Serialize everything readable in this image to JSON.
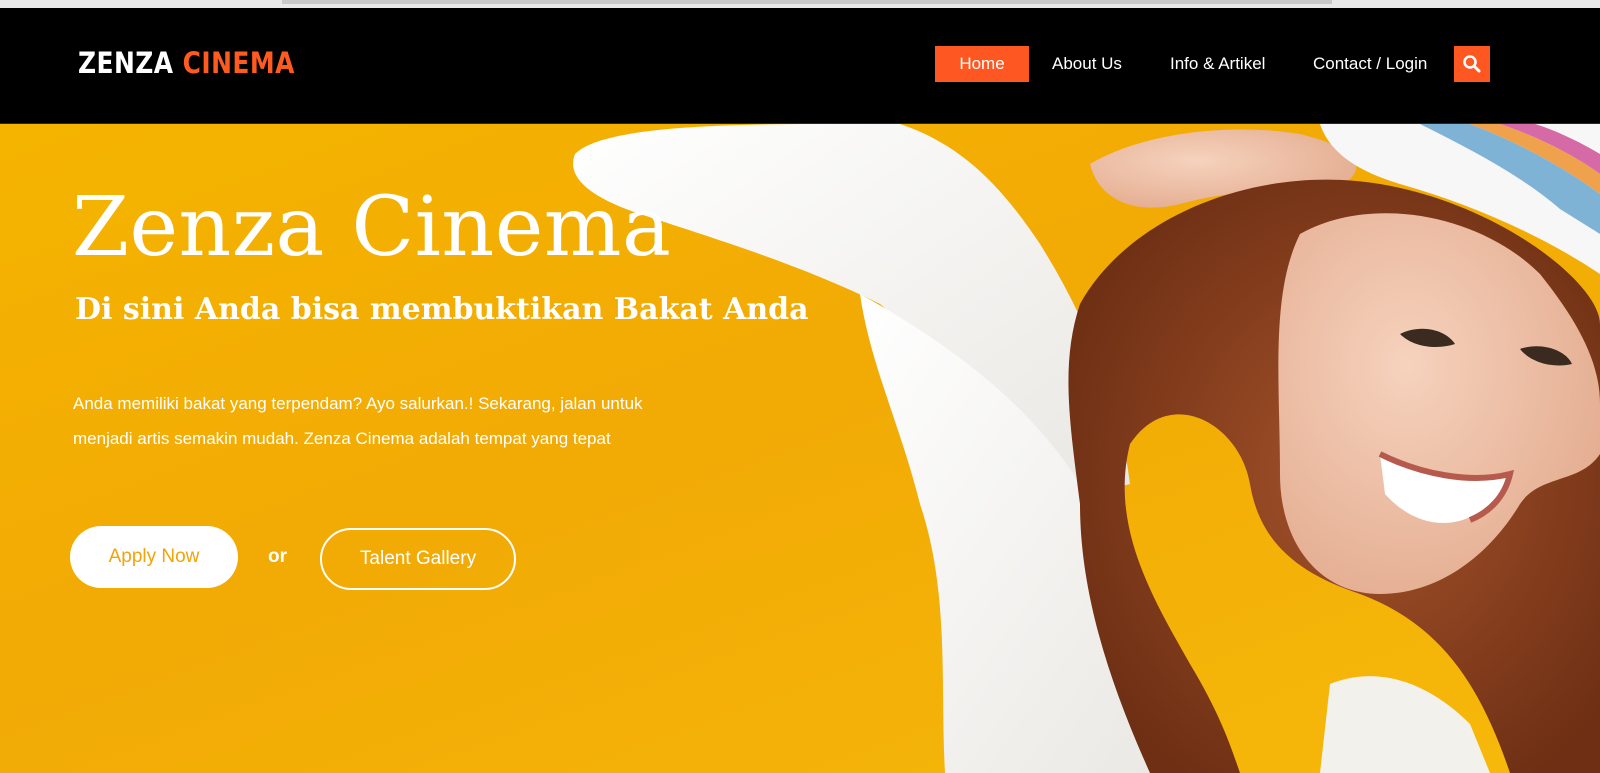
{
  "brand": {
    "logo_part1": "ZENZA",
    "logo_part2": "CINEMA"
  },
  "nav": {
    "items": [
      {
        "label": "Home",
        "active": true
      },
      {
        "label": "About Us",
        "active": false
      },
      {
        "label": "Info & Artikel",
        "active": false
      },
      {
        "label": "Contact / Login",
        "active": false
      }
    ],
    "search_icon": "search-icon"
  },
  "hero": {
    "title": "Zenza Cinema",
    "subtitle": "Di sini Anda bisa membuktikan Bakat Anda",
    "description": "Anda memiliki bakat yang terpendam? Ayo salurkan.! Sekarang, jalan untuk menjadi artis semakin mudah. Zenza Cinema adalah tempat yang tepat",
    "apply_label": "Apply Now",
    "or_label": "or",
    "gallery_label": "Talent Gallery"
  },
  "colors": {
    "accent": "#ff5722",
    "hero_background": "#f5b400",
    "navbar_background": "#000000"
  }
}
